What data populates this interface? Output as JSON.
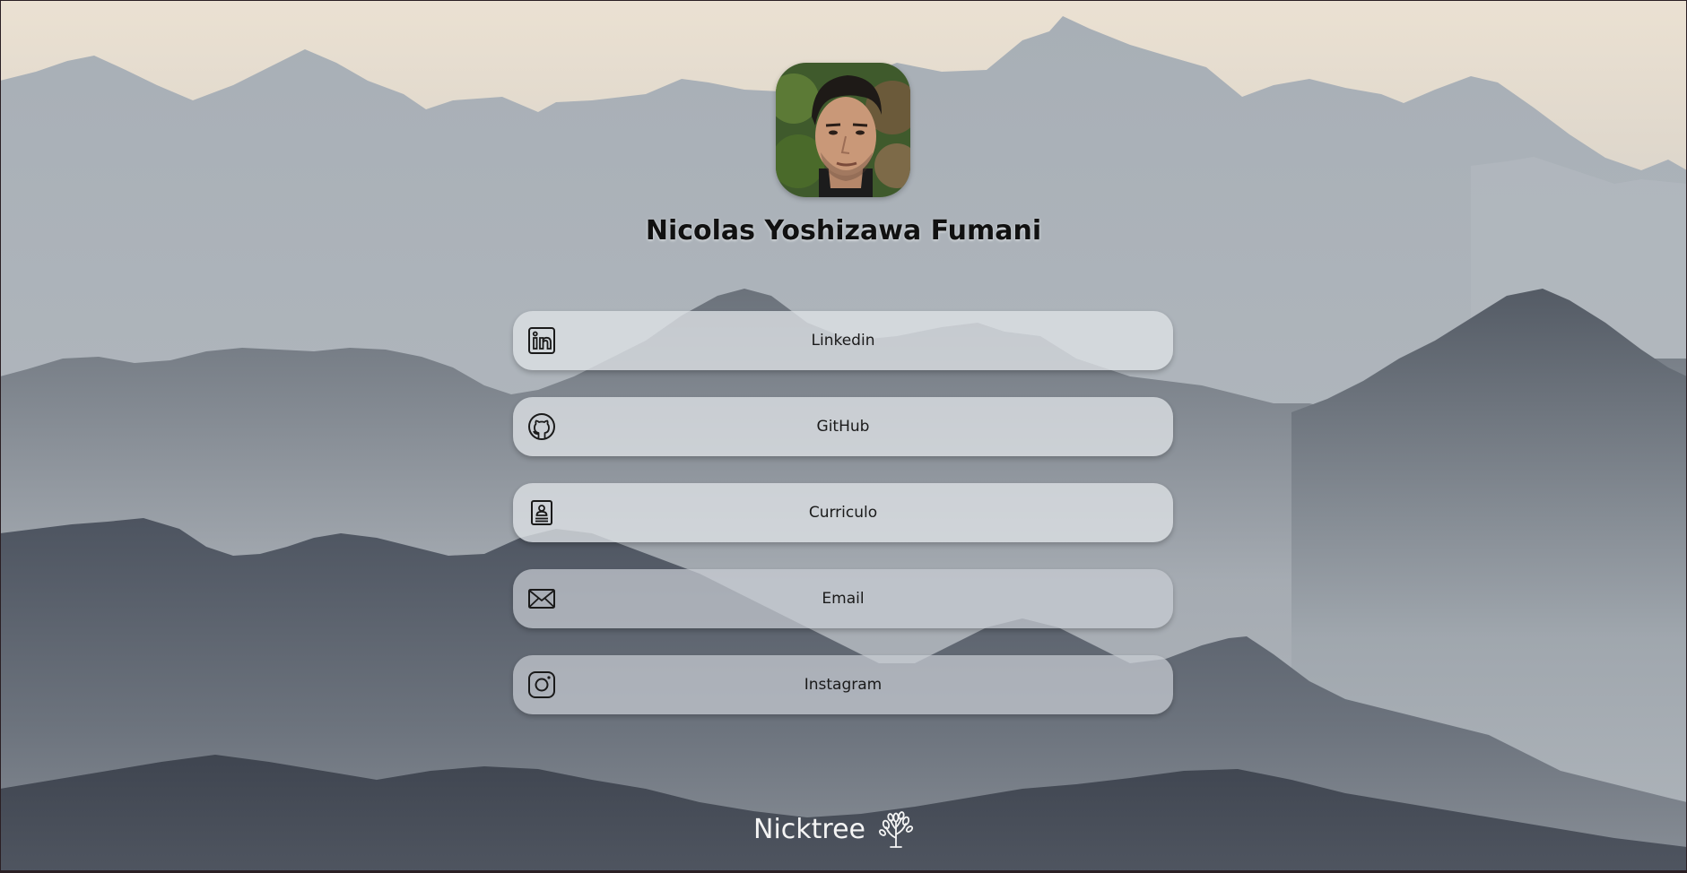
{
  "profile": {
    "name": "Nicolas Yoshizawa Fumani",
    "avatar_icon": "profile-photo"
  },
  "links": [
    {
      "label": "Linkedin",
      "icon": "linkedin-icon"
    },
    {
      "label": "GitHub",
      "icon": "github-icon"
    },
    {
      "label": "Curriculo",
      "icon": "resume-icon"
    },
    {
      "label": "Email",
      "icon": "mail-icon"
    },
    {
      "label": "Instagram",
      "icon": "instagram-icon"
    }
  ],
  "footer": {
    "brand": "Nicktree",
    "logo_icon": "tree-icon"
  },
  "colors": {
    "sky": "#e6dccd",
    "mountain_far": "#a9b0b7",
    "mountain_dark": "#3e444d",
    "button_bg": "#dee2e6",
    "text": "#1a1a1a"
  }
}
